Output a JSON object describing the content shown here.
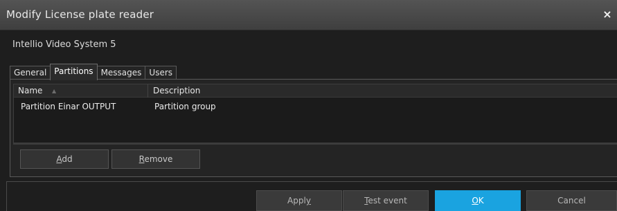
{
  "window": {
    "title": "Modify License plate reader",
    "close_label": "×"
  },
  "system_name": "Intellio Video System 5",
  "tabs": [
    {
      "label": "General"
    },
    {
      "label": "Partitions",
      "active": true
    },
    {
      "label": "Messages"
    },
    {
      "label": "Users"
    }
  ],
  "partitions": {
    "columns": [
      {
        "label": "Name"
      },
      {
        "label": "Description"
      }
    ],
    "sort_indicator": "▲",
    "rows": [
      {
        "name": "Partition Einar OUTPUT",
        "description": "Partition group"
      }
    ],
    "add": {
      "accel": "A",
      "rest": "dd"
    },
    "remove": {
      "accel": "R",
      "rest": "emove"
    }
  },
  "footer": {
    "apply": {
      "pre": "Appl",
      "accel": "y"
    },
    "test_event": {
      "accel": "T",
      "rest": "est event"
    },
    "ok": {
      "accel": "O",
      "rest": "K"
    },
    "cancel": {
      "label": "Cancel"
    }
  },
  "colors": {
    "accent": "#1aa3e0",
    "background": "#1e1e1e",
    "titlebar": "#4a4a4a"
  }
}
